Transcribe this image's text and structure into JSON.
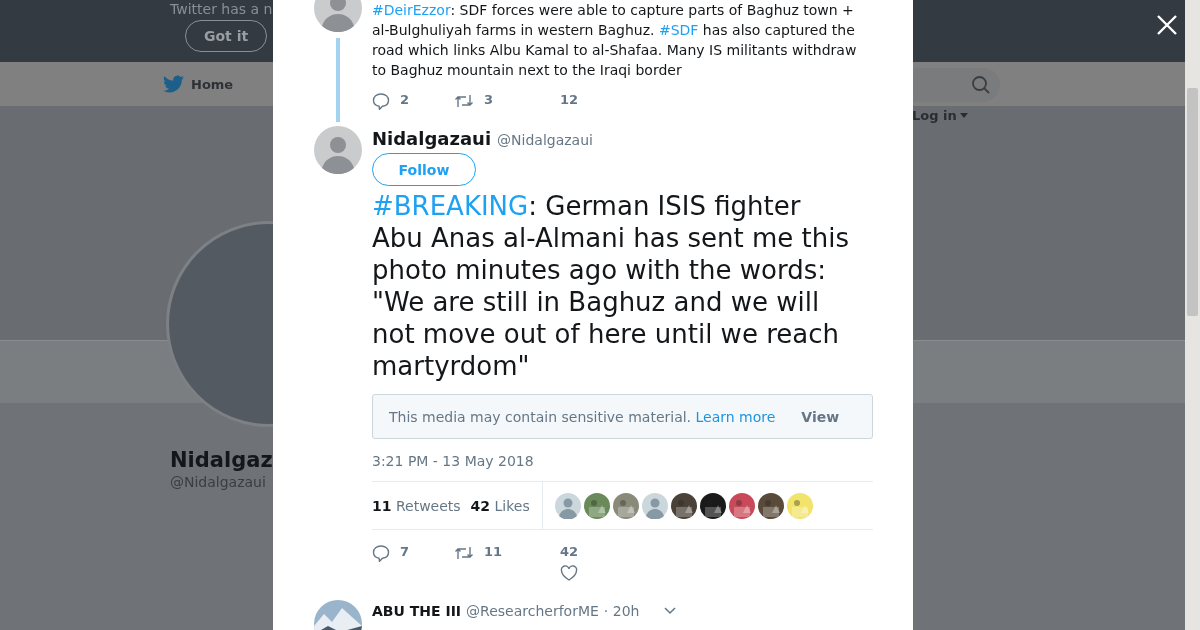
{
  "background_page": {
    "banner_text": "Twitter has a n",
    "banner_button": "Got it",
    "nav_home": "Home",
    "login": "Log in",
    "profile_name": "Nidalgaz",
    "profile_handle": "@Nidalgazaui"
  },
  "parent_tweet": {
    "text": [
      {
        "kind": "hashtag",
        "text": "#DeirEzzor"
      },
      {
        "kind": "plain",
        "text": ": SDF forces were able to capture parts of Baghuz town + al-Bulghuliyah farms in western Baghuz. "
      },
      {
        "kind": "hashtag",
        "text": "#SDF"
      },
      {
        "kind": "plain",
        "text": " has also captured the road which links Albu Kamal to al-Shafaa. Many IS militants withdraw to Baghuz mountain next to the Iraqi border"
      }
    ],
    "reply_count": "2",
    "retweet_count": "3",
    "like_count": "12"
  },
  "tweet": {
    "name": "Nidalgazaui",
    "handle": "@Nidalgazaui",
    "follow_button": "Follow",
    "text": [
      {
        "kind": "hashtag",
        "text": "#BREAKING"
      },
      {
        "kind": "plain",
        "text": ": German ISIS fighter Abu Anas al-Almani has sent me this photo minutes ago with the words: \"We are still in Baghuz and we will not move out of here until we reach martyrdom\""
      }
    ],
    "media_notice": "This media may contain sensitive material.",
    "learn_more": "Learn more",
    "view_button": "View",
    "timestamp": "3:21 PM - 13 May 2018",
    "retweets": {
      "count": "11",
      "label": "Retweets"
    },
    "likes": {
      "count": "42",
      "label": "Likes"
    },
    "likers": [
      {
        "kind": "default"
      },
      {
        "kind": "picture",
        "color": "#6a8a5a"
      },
      {
        "kind": "picture",
        "color": "#8a8a7a"
      },
      {
        "kind": "default"
      },
      {
        "kind": "picture",
        "color": "#4a4238"
      },
      {
        "kind": "picture",
        "color": "#1a1a1a"
      },
      {
        "kind": "picture",
        "color": "#c84a5a"
      },
      {
        "kind": "picture",
        "color": "#5a4a3a"
      },
      {
        "kind": "picture",
        "color": "#f2e36a"
      }
    ],
    "reply_count": "7",
    "retweet_count": "11",
    "like_count": "42"
  },
  "reply": {
    "name": "ABU THE III",
    "handle": "@ResearcherforME",
    "time": "· 20h"
  }
}
